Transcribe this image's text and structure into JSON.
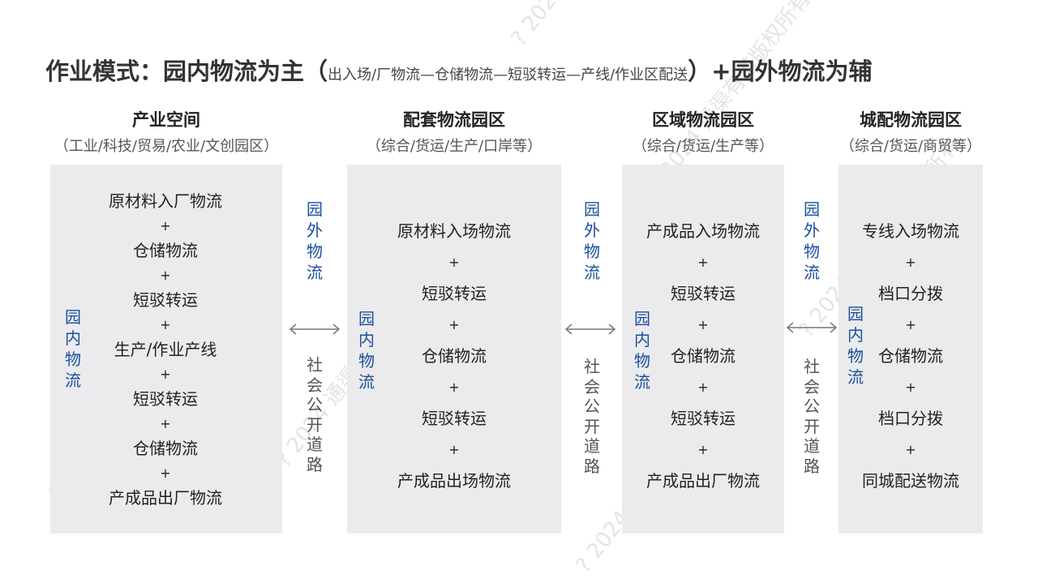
{
  "title": {
    "main": "作业模式：园内物流为主",
    "open": "（",
    "detail": "出入场/厂物流—仓储物流—短驳转运—产线/作业区配送",
    "close": "）",
    "tail": "+园外物流为辅"
  },
  "columns": [
    {
      "heading": "产业空间",
      "subheading": "（工业/科技/贸易/农业/文创园区）",
      "steps": [
        "原材料入厂物流",
        "仓储物流",
        "短驳转运",
        "生产/作业产线",
        "短驳转运",
        "仓储物流",
        "产成品出厂物流"
      ]
    },
    {
      "heading": "配套物流园区",
      "subheading": "（综合/货运/生产/口岸等）",
      "steps": [
        "原材料入场物流",
        "短驳转运",
        "仓储物流",
        "短驳转运",
        "产成品出场物流"
      ]
    },
    {
      "heading": "区域物流园区",
      "subheading": "（综合/货运/生产等）",
      "steps": [
        "产成品入场物流",
        "短驳转运",
        "仓储物流",
        "短驳转运",
        "产成品出厂物流"
      ]
    },
    {
      "heading": "城配物流园区",
      "subheading": "（综合/货运/商贸等）",
      "steps": [
        "专线入场物流",
        "档口分拨",
        "仓储物流",
        "档口分拨",
        "同城配送物流"
      ]
    }
  ],
  "plus_sign": "+",
  "inner_label": "园内物流",
  "outer_label": "园外物流",
  "road_label": "社会公开道路",
  "watermark": "? 2024 通渠有道版权所有.",
  "colors": {
    "box": "#ebebee",
    "label_blue": "#1a4f9c",
    "watermark": "#e4e4e8"
  }
}
